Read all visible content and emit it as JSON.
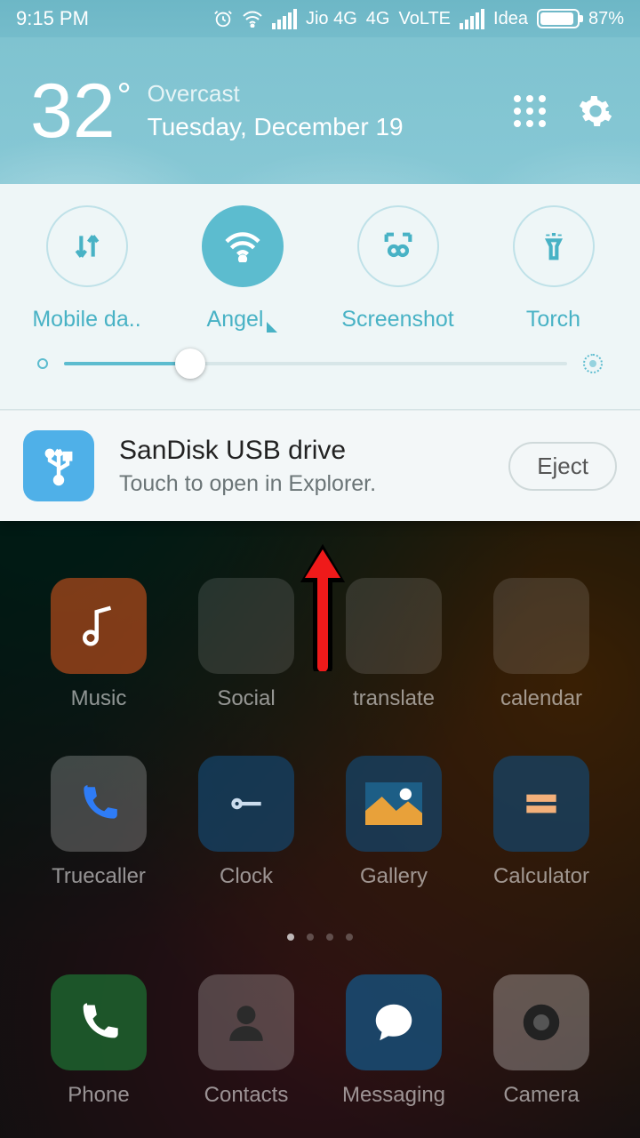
{
  "statusbar": {
    "time": "9:15 PM",
    "carrier1_net": "Jio 4G",
    "carrier1_extra": "4G",
    "volte": "VoLTE",
    "carrier2": "Idea",
    "battery_pct": "87%"
  },
  "weather": {
    "temp": "32",
    "degree": "°",
    "condition": "Overcast",
    "date": "Tuesday, December 19"
  },
  "toggles": {
    "data_label": "Mobile da..",
    "wifi_label": "Angel",
    "screenshot_label": "Screenshot",
    "torch_label": "Torch"
  },
  "notif": {
    "title": "SanDisk USB drive",
    "sub": "Touch to open in Explorer.",
    "eject": "Eject"
  },
  "home": {
    "row1": [
      "Music",
      "Social",
      "translate",
      "calendar"
    ],
    "row2": [
      "Truecaller",
      "Clock",
      "Gallery",
      "Calculator"
    ],
    "dock": [
      "Phone",
      "Contacts",
      "Messaging",
      "Camera"
    ]
  }
}
